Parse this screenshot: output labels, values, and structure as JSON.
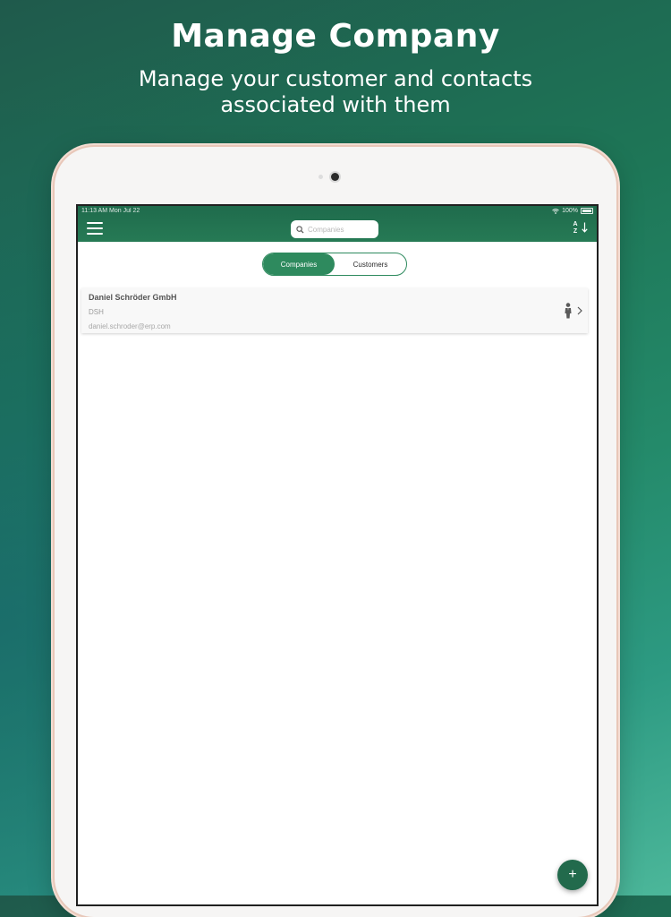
{
  "promo": {
    "title": "Manage Company",
    "subtitle": "Manage your customer and contacts associated with them"
  },
  "status_bar": {
    "time_date": "11:13 AM   Mon Jul 22",
    "battery": "100%"
  },
  "header": {
    "menu_icon": "hamburger-menu-icon",
    "search_placeholder": "Companies",
    "search_icon": "search-icon",
    "sort_label_top": "A",
    "sort_label_bottom": "Z",
    "sort_icon": "sort-az-icon"
  },
  "segments": [
    {
      "label": "Companies",
      "active": true
    },
    {
      "label": "Customers",
      "active": false
    }
  ],
  "companies": [
    {
      "name": "Daniel Schröder GmbH",
      "code": "DSH",
      "email": "daniel.schroder@erp.com",
      "contact_icon": "person-icon",
      "chevron_icon": "chevron-right-icon"
    }
  ],
  "fab": {
    "label": "+",
    "icon": "add-icon"
  },
  "colors": {
    "primary_green": "#2e8a5e",
    "header_green": "#1f6b4c",
    "fab_green": "#226a4c"
  }
}
